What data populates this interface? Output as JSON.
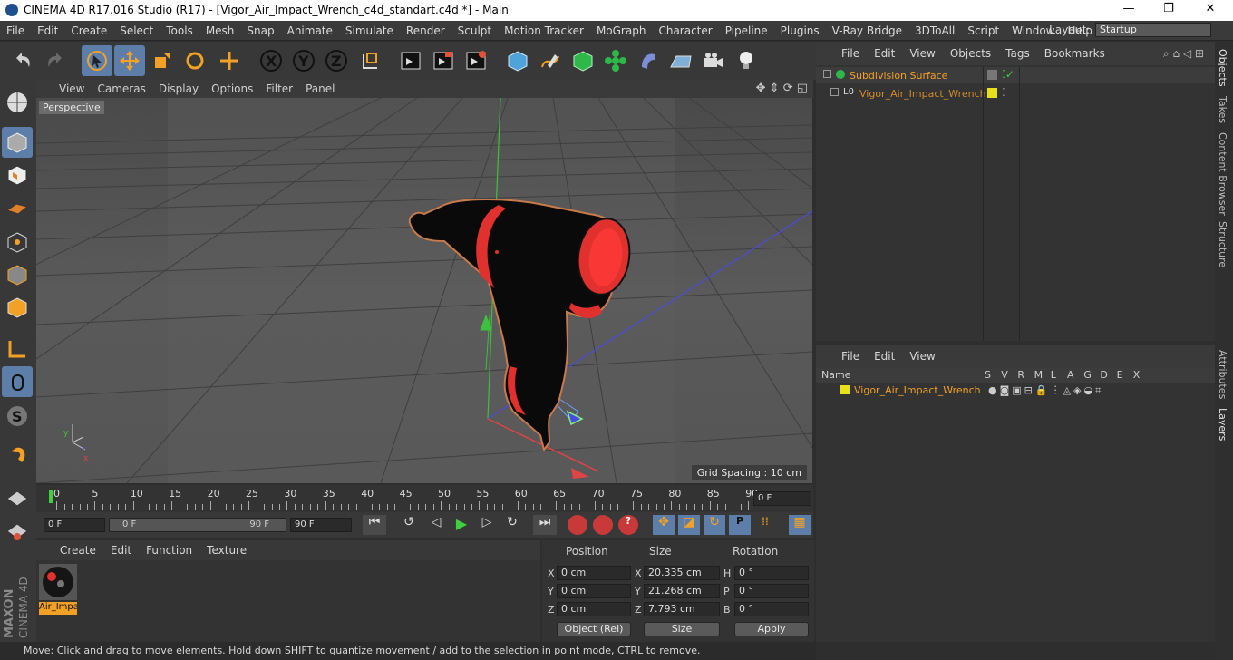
{
  "app": {
    "title": "CINEMA 4D R17.016 Studio (R17) - [Vigor_Air_Impact_Wrench_c4d_standart.c4d *] - Main",
    "window_controls": [
      "—",
      "❐",
      "✕"
    ]
  },
  "menu": [
    "File",
    "Edit",
    "Create",
    "Select",
    "Tools",
    "Mesh",
    "Snap",
    "Animate",
    "Simulate",
    "Render",
    "Sculpt",
    "Motion Tracker",
    "MoGraph",
    "Character",
    "Pipeline",
    "Plugins",
    "V-Ray Bridge",
    "3DToAll",
    "Script",
    "Window",
    "Help"
  ],
  "layout": {
    "label": "Layout:",
    "value": "Startup"
  },
  "viewport": {
    "menu": [
      "View",
      "Cameras",
      "Display",
      "Options",
      "Filter",
      "Panel"
    ],
    "label": "Perspective",
    "grid_spacing": "Grid Spacing : 10 cm"
  },
  "timeline": {
    "ticks": [
      "0",
      "5",
      "10",
      "15",
      "20",
      "25",
      "30",
      "35",
      "40",
      "45",
      "50",
      "55",
      "60",
      "65",
      "70",
      "75",
      "80",
      "85",
      "90"
    ],
    "end_field": "0 F"
  },
  "transport": {
    "start": "0 F",
    "range_start": "0 F",
    "range_end": "90 F",
    "end": "90 F"
  },
  "material": {
    "menu": [
      "Create",
      "Edit",
      "Function",
      "Texture"
    ],
    "item": "Air_Impa"
  },
  "coords": {
    "headers": [
      "Position",
      "Size",
      "Rotation"
    ],
    "rows": [
      {
        "axis": "X",
        "pos": "0 cm",
        "saxis": "X",
        "size": "20.335 cm",
        "raxis": "H",
        "rot": "0 °"
      },
      {
        "axis": "Y",
        "pos": "0 cm",
        "saxis": "Y",
        "size": "21.268 cm",
        "raxis": "P",
        "rot": "0 °"
      },
      {
        "axis": "Z",
        "pos": "0 cm",
        "saxis": "Z",
        "size": "7.793 cm",
        "raxis": "B",
        "rot": "0 °"
      }
    ],
    "mode": "Object (Rel)",
    "size_mode": "Size",
    "apply": "Apply"
  },
  "objects": {
    "menu": [
      "File",
      "Edit",
      "View",
      "Objects",
      "Tags",
      "Bookmarks"
    ],
    "items": [
      "Subdivision Surface",
      "Vigor_Air_Impact_Wrench"
    ]
  },
  "layers": {
    "menu": [
      "File",
      "Edit",
      "View"
    ],
    "columns": [
      "Name",
      "S",
      "V",
      "R",
      "M",
      "L",
      "A",
      "G",
      "D",
      "E",
      "X"
    ],
    "item": "Vigor_Air_Impact_Wrench"
  },
  "side_tabs": [
    "Objects",
    "Takes",
    "Content Browser",
    "Structure",
    "Attributes",
    "Layers"
  ],
  "status": "Move: Click and drag to move elements. Hold down SHIFT to quantize movement / add to the selection in point mode, CTRL to remove.",
  "colors": {
    "accent": "#5c7ea8",
    "orange": "#f3a126",
    "background": "#333333"
  }
}
